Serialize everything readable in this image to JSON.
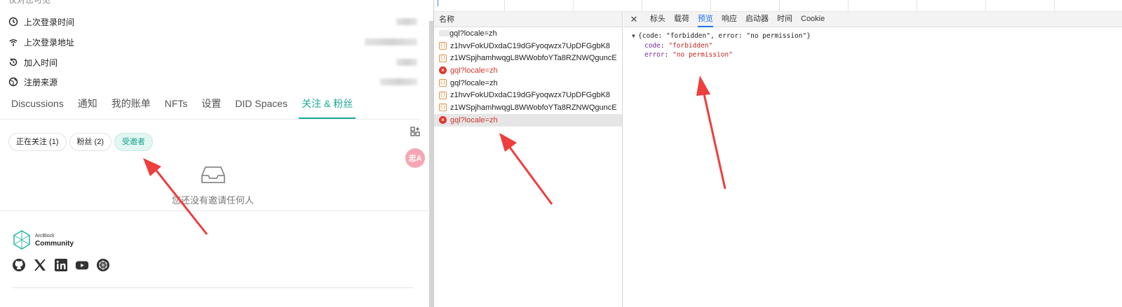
{
  "left": {
    "cut_text": "仅对您可见",
    "info_rows": [
      {
        "label": "上次登录时间",
        "icon": "clock-icon"
      },
      {
        "label": "上次登录地址",
        "icon": "signal-icon"
      },
      {
        "label": "加入时间",
        "icon": "history-icon"
      },
      {
        "label": "注册来源",
        "icon": "globe-icon"
      }
    ],
    "tabs": [
      "Discussions",
      "通知",
      "我的账单",
      "NFTs",
      "设置",
      "DID Spaces",
      "关注 & 粉丝"
    ],
    "active_tab": "关注 & 粉丝",
    "chips": [
      {
        "label": "正在关注 (1)",
        "active": false
      },
      {
        "label": "粉丝 (2)",
        "active": false
      },
      {
        "label": "受邀者",
        "active": true
      }
    ],
    "empty_text": "您还没有邀请任何人",
    "translate_label": "忠A",
    "brand": {
      "small": "ArcBlock",
      "big": "Community"
    },
    "socials": [
      "github-icon",
      "x-icon",
      "linkedin-icon",
      "youtube-icon",
      "arcblock-icon"
    ],
    "accent_color": "#1aa898"
  },
  "devtools": {
    "name_header": "名称",
    "requests": [
      {
        "name": "gql?locale=zh",
        "type": "blank",
        "error": false,
        "selected": false
      },
      {
        "name": "z1hvvFokUDxdaC19dGFyoqwzx7UpDFGgbK8",
        "type": "fetch",
        "error": false,
        "selected": false
      },
      {
        "name": "z1WSpjhamhwqgL8WWobfoYTa8RZNWQguncE",
        "type": "fetch",
        "error": false,
        "selected": false
      },
      {
        "name": "gql?locale=zh",
        "type": "error",
        "error": true,
        "selected": false
      },
      {
        "name": "gql?locale=zh",
        "type": "fetch",
        "error": false,
        "selected": false
      },
      {
        "name": "z1hvvFokUDxdaC19dGFyoqwzx7UpDFGgbK8",
        "type": "fetch",
        "error": false,
        "selected": false
      },
      {
        "name": "z1WSpjhamhwqgL8WWobfoYTa8RZNWQguncE",
        "type": "fetch",
        "error": false,
        "selected": false
      },
      {
        "name": "gql?locale=zh",
        "type": "error",
        "error": true,
        "selected": true
      }
    ],
    "detail_tabs": [
      "标头",
      "载荷",
      "预览",
      "响应",
      "启动器",
      "时间",
      "Cookie"
    ],
    "active_detail_tab": "预览",
    "preview": {
      "summary": "{code: \"forbidden\", error: \"no permission\"}",
      "lines": [
        {
          "key": "code",
          "value": "\"forbidden\""
        },
        {
          "key": "error",
          "value": "\"no permission\""
        }
      ]
    },
    "error_color": "#d0382b",
    "tab_accent": "#1a73e8"
  }
}
